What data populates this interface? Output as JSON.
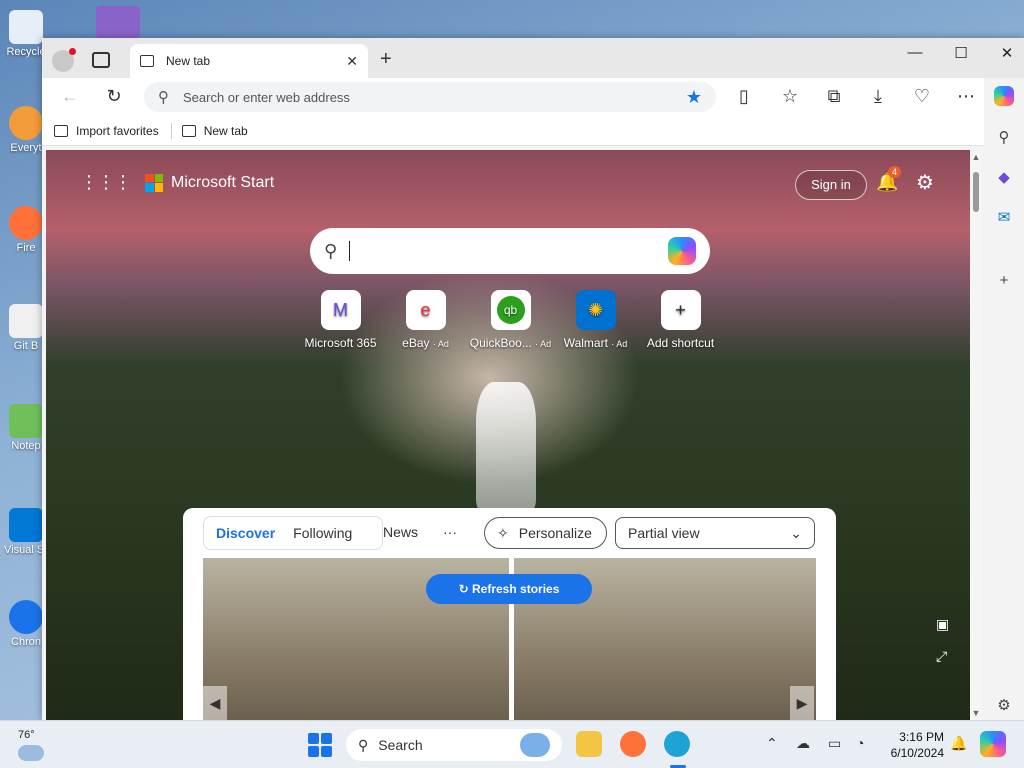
{
  "desktop": {
    "icons": [
      {
        "label": "Recycle",
        "color": "#e6eef7"
      },
      {
        "label": "Everyt",
        "color": "#f29c3b"
      },
      {
        "label": "Fire",
        "color": "#ff7139"
      },
      {
        "label": "Git B",
        "color": "#f0f0f0"
      },
      {
        "label": "Notep",
        "color": "#6fbf5a"
      },
      {
        "label": "Visual S Co",
        "color": "#0078d4"
      },
      {
        "label": "Chron",
        "color": "#1a73e8"
      }
    ]
  },
  "browser": {
    "tab": {
      "label": "New tab",
      "close": "✕"
    },
    "new_tab_button": "+",
    "window_controls": {
      "minimize": "—",
      "maximize": "☐",
      "close": "✕"
    },
    "address": {
      "placeholder": "Search or enter web address"
    },
    "favorites_bar": [
      {
        "label": "Import favorites"
      },
      {
        "label": "New tab"
      }
    ]
  },
  "page": {
    "brand": "Microsoft Start",
    "sign_in": "Sign in",
    "notification_count": "4",
    "shortcuts": [
      {
        "label": "Microsoft 365",
        "ad": "",
        "icon": "M"
      },
      {
        "label": "eBay",
        "ad": "· Ad",
        "icon": "e"
      },
      {
        "label": "QuickBoo...",
        "ad": "· Ad",
        "icon": "qb"
      },
      {
        "label": "Walmart",
        "ad": "· Ad",
        "icon": "✺"
      },
      {
        "label": "Add shortcut",
        "ad": "",
        "icon": "+"
      }
    ],
    "feed": {
      "tabs": [
        "Discover",
        "Following"
      ],
      "news": "News",
      "more": "···",
      "personalize": "Personalize",
      "view_select": "Partial view",
      "refresh": "Refresh stories"
    }
  },
  "taskbar": {
    "weather_temp": "76°",
    "search_label": "Search",
    "time": "3:16 PM",
    "date": "6/10/2024"
  }
}
